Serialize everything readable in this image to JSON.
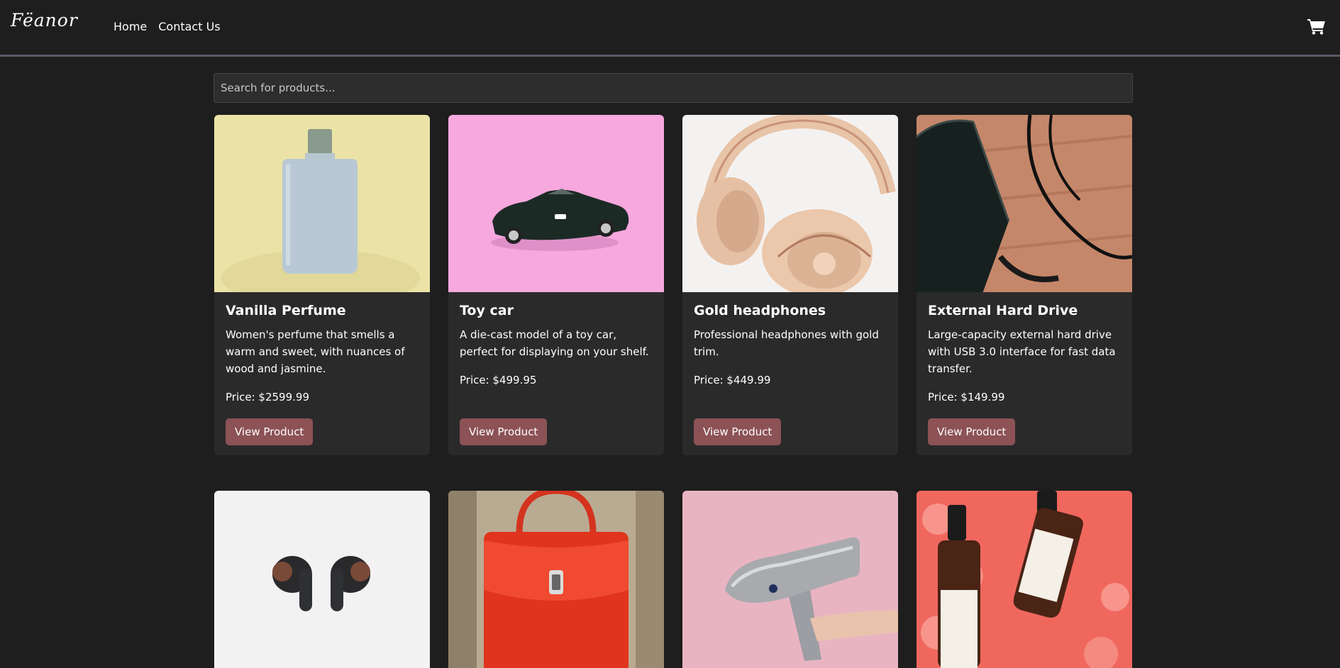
{
  "brand": {
    "logo_text": "Fëanor"
  },
  "nav": {
    "home_label": "Home",
    "contact_label": "Contact Us"
  },
  "search": {
    "placeholder": "Search for products..."
  },
  "products": [
    {
      "title": "Vanilla Perfume",
      "description": "Women's perfume that smells a warm and sweet, with nuances of wood and jasmine.",
      "price": "Price: $2599.99",
      "button": "View Product"
    },
    {
      "title": "Toy car",
      "description": "A die-cast model of a toy car, perfect for displaying on your shelf.",
      "price": "Price: $499.95",
      "button": "View Product"
    },
    {
      "title": "Gold headphones",
      "description": "Professional headphones with gold trim.",
      "price": "Price: $449.99",
      "button": "View Product"
    },
    {
      "title": "External Hard Drive",
      "description": "Large-capacity external hard drive with USB 3.0 interface for fast data transfer.",
      "price": "Price: $149.99",
      "button": "View Product"
    }
  ],
  "image_icons": [
    "perfume-bottle",
    "toy-car",
    "headphones",
    "hard-drive",
    "earbuds",
    "handbag",
    "hair-dryer",
    "serum-bottles"
  ],
  "colors": {
    "background": "#1e1e1e",
    "card": "#2a2a2a",
    "button": "#8c5256",
    "nav_border": "#5f5667"
  }
}
